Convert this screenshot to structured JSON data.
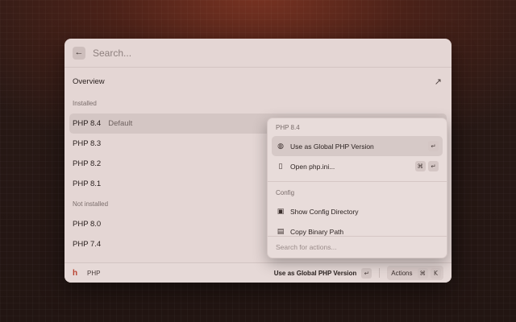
{
  "search": {
    "placeholder": "Search..."
  },
  "list": {
    "overview_label": "Overview",
    "installed_label": "Installed",
    "installed": [
      {
        "name": "PHP 8.4",
        "tag": "Default"
      },
      {
        "name": "PHP 8.3",
        "tag": ""
      },
      {
        "name": "PHP 8.2",
        "tag": ""
      },
      {
        "name": "PHP 8.1",
        "tag": ""
      }
    ],
    "not_installed_label": "Not installed",
    "not_installed": [
      {
        "name": "PHP 8.0"
      },
      {
        "name": "PHP 7.4"
      }
    ]
  },
  "footer": {
    "title": "PHP",
    "primary_action": "Use as Global PHP Version",
    "enter_key": "↵",
    "actions_label": "Actions",
    "cmd_key": "⌘",
    "k_key": "K"
  },
  "popover": {
    "section1_label": "PHP 8.4",
    "items1": [
      {
        "label": "Use as Global PHP Version",
        "key1": "↵"
      },
      {
        "label": "Open php.ini...",
        "key1": "⌘",
        "key2": "↵"
      }
    ],
    "section2_label": "Config",
    "items2": [
      {
        "label": "Show Config Directory"
      },
      {
        "label": "Copy Binary Path"
      }
    ],
    "search_placeholder": "Search for actions..."
  },
  "colors": {
    "accent": "#b8412f",
    "background": "#e4d6d4"
  }
}
